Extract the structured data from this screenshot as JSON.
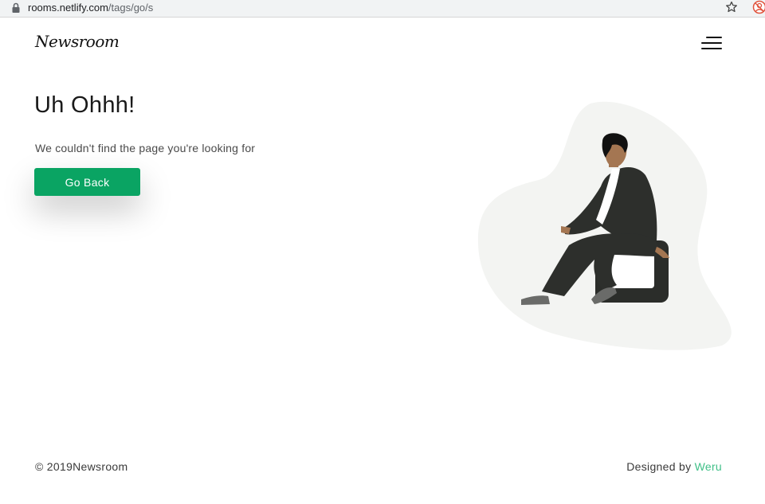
{
  "browser": {
    "url_host": "rooms.netlify.com",
    "url_path": "/tags/go/s",
    "icons": [
      "lock-icon",
      "star-icon",
      "profile-icon"
    ]
  },
  "header": {
    "logo": "Newsroom",
    "menu_icon": "hamburger-menu-icon"
  },
  "main": {
    "headline": "Uh Ohhh!",
    "message": "We couldn't find the page you're looking for",
    "button_label": "Go Back"
  },
  "footer": {
    "copyright": "© 2019Newsroom",
    "designed_by_prefix": "Designed by ",
    "designer": "Weru"
  },
  "colors": {
    "accent_green": "#0aa463",
    "link_green": "#3fbf87",
    "blob": "#f3f4f2",
    "suit": "#2d2f2c"
  }
}
